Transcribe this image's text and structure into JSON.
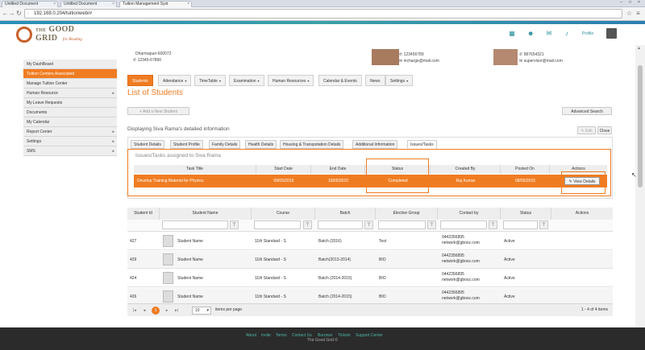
{
  "browser": {
    "tabs": [
      "Untitled Document",
      "Untitled Document",
      "Tuition Management Syst"
    ],
    "url": "192.168.0.204/tuitionweb/#"
  },
  "header": {
    "logo_line1": "THE",
    "logo_line2": "GOOD",
    "logo_line3": "GRID",
    "logo_tagline": "for Reading",
    "profile_label": "Profile"
  },
  "center_info": {
    "city": "Dharmapuri-600072",
    "phone": "12345-67890"
  },
  "contacts": [
    {
      "phone": "123456789",
      "email": "incharge@mail.com"
    },
    {
      "phone": "987654321",
      "email": "supervisor@mail.com"
    }
  ],
  "sidebar": {
    "items": [
      {
        "label": "My DashBoard",
        "arrow": false,
        "active": false
      },
      {
        "label": "Tuition Centers Associated",
        "arrow": false,
        "active": true
      },
      {
        "label": "Manage Tuition Center",
        "arrow": false,
        "active": false
      },
      {
        "label": "Human Resource",
        "arrow": true,
        "active": false
      },
      {
        "label": "My Leave Requests",
        "arrow": false,
        "active": false
      },
      {
        "label": "Documents",
        "arrow": false,
        "active": false
      },
      {
        "label": "My Calendar",
        "arrow": false,
        "active": false
      },
      {
        "label": "Report Center",
        "arrow": true,
        "active": false
      },
      {
        "label": "Settings",
        "arrow": true,
        "active": false
      },
      {
        "label": "SMS",
        "arrow": true,
        "active": false
      }
    ]
  },
  "menubar": [
    "Students",
    "Attendance",
    "TimeTable",
    "Examination",
    "Human Resources",
    "Calendar & Events",
    "News",
    "Settings"
  ],
  "page": {
    "title": "List of Students",
    "add_button": "+ Add a New Student",
    "advanced_search": "Advanced Search",
    "displaying": "Displaying Siva Rama's detailed information",
    "edit": "Edit",
    "close": "Close"
  },
  "detail_tabs": [
    "Student Details",
    "Student Profile",
    "Family Details",
    "Health Details",
    "Housing & Transpotation Details",
    "Additional Information",
    "Issues/Tasks"
  ],
  "issues": {
    "title": "Issues/Tasks assigned to Siva Rama",
    "headers": [
      "Task Title",
      "Start Date",
      "End Date",
      "Status",
      "Created By",
      "Posted On",
      "Actions"
    ],
    "row": {
      "task": "Develop Training Material for Physics",
      "start": "09/05/2015",
      "end": "10/05/2015",
      "status": "Completed",
      "created_by": "Raj Kumar",
      "posted_on": "08/05/2015",
      "action": "View Details"
    },
    "row_color": "#f07c22"
  },
  "students": {
    "headers": [
      "Student Id",
      "Student Name",
      "Course",
      "Batch",
      "Elective Group",
      "Contact by",
      "Status",
      "Actions"
    ],
    "rows": [
      {
        "id": "427",
        "name": "Student Name",
        "course": "11th Standard - S",
        "batch": "Batch (2016)",
        "group": "Test",
        "phone": "0442356895",
        "email": "network@gboxz.com",
        "status": "Active"
      },
      {
        "id": "429",
        "name": "Student Name",
        "course": "11th Standard - S",
        "batch": "Batch(2013-2014)",
        "group": "BIO",
        "phone": "0442356895",
        "email": "network@gboxz.com",
        "status": "Active"
      },
      {
        "id": "424",
        "name": "Student Name",
        "course": "11th Standard - S",
        "batch": "Batch (2014-2015)",
        "group": "BIO",
        "phone": "0442356895",
        "email": "network@gboxz.com",
        "status": "Active"
      },
      {
        "id": "426",
        "name": "Student Name",
        "course": "11th Standard - S",
        "batch": "Batch (2014-2015)",
        "group": "BIO",
        "phone": "0442356895",
        "email": "network@gboxz.com",
        "status": "Active"
      }
    ]
  },
  "pager": {
    "current_page": "1",
    "page_size": "10",
    "items_per_page": "items per page",
    "summary": "1 - 4 of 4 items"
  },
  "footer": {
    "links": [
      "About",
      "Invite",
      "Terms",
      "Contact Us",
      "Burrows",
      "Tickets",
      "Support Center"
    ],
    "copyright": "The Good Grid ©"
  }
}
